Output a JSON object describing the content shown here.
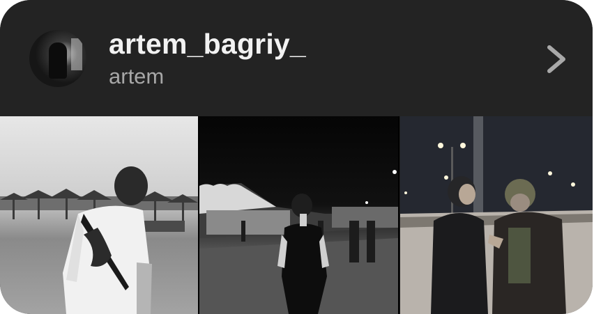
{
  "profile": {
    "username": "artem_bagriy_",
    "full_name": "artem",
    "avatar_icon": "profile-avatar",
    "open_icon": "chevron-right-icon"
  },
  "photos": [
    {
      "scene": "beach-bw"
    },
    {
      "scene": "night-street"
    },
    {
      "scene": "night-road"
    }
  ],
  "colors": {
    "card_bg": "#232323",
    "username": "#f2f2f2",
    "full_name": "#a7a7a7",
    "chevron": "#a8a8a8"
  }
}
